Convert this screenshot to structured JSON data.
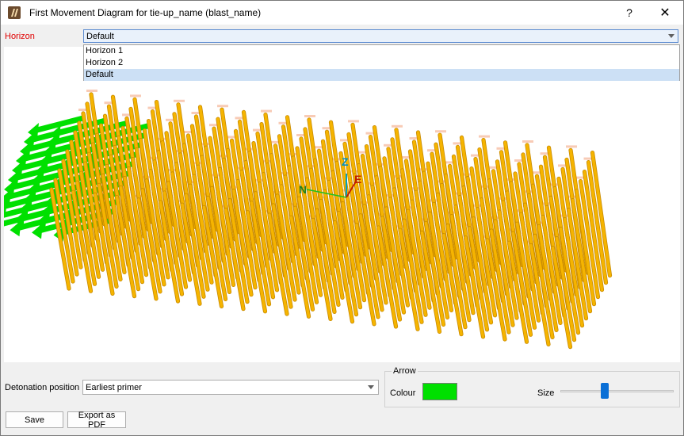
{
  "window": {
    "title": "First Movement Diagram for tie-up_name (blast_name)",
    "help_glyph": "?",
    "close_glyph": "✕"
  },
  "horizon": {
    "label": "Horizon",
    "label_color": "#e00000",
    "selected": "Default",
    "options": [
      "Horizon 1",
      "Horizon 2",
      "Default"
    ]
  },
  "viewport": {
    "axis_labels": {
      "z": "Z",
      "e": "E",
      "n": "N"
    },
    "hole_color": "#f5b400",
    "arrow_color": "#00e000",
    "hole_label_color": "#f2a07a"
  },
  "detonation": {
    "label": "Detonation position",
    "selected": "Earliest primer"
  },
  "arrow": {
    "group_title": "Arrow",
    "colour_label": "Colour",
    "colour": "#00e000",
    "size_label": "Size",
    "size_level": 0.38
  },
  "buttons": {
    "save": "Save",
    "export": "Export as PDF"
  }
}
